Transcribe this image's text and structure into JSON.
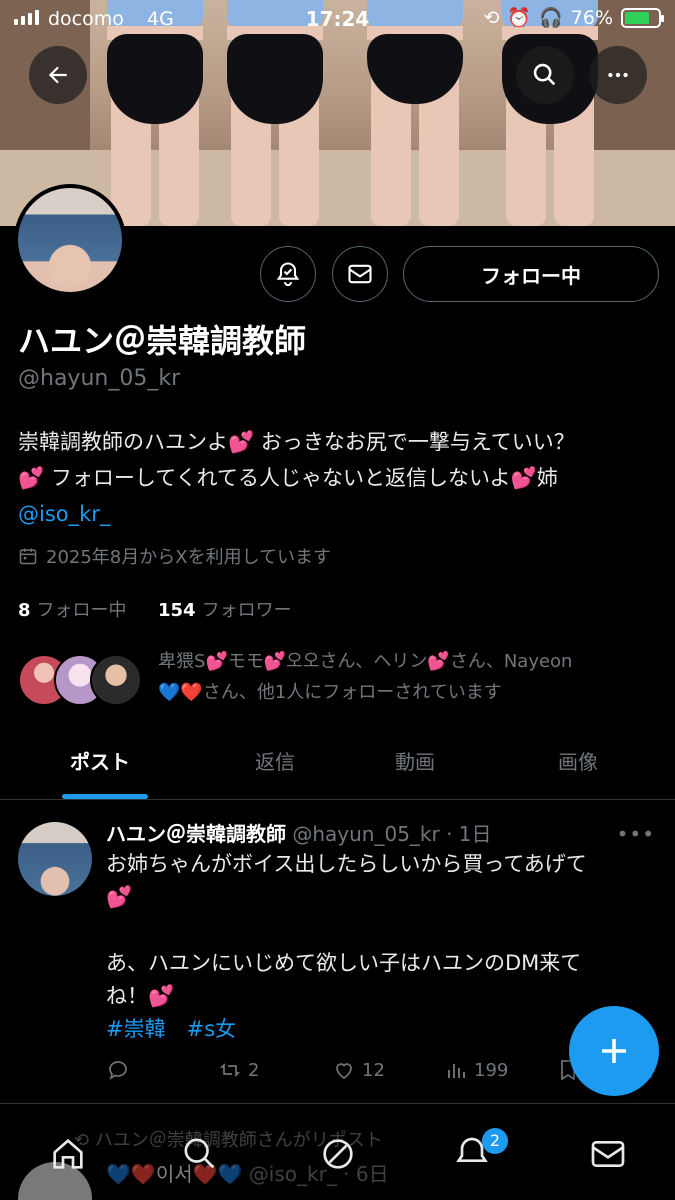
{
  "status_bar": {
    "carrier": "docomo",
    "network": "4G",
    "time": "17:24",
    "battery_percent": "76%",
    "battery_level": 0.76
  },
  "profile": {
    "display_name": "ハユン＠崇韓調教師",
    "handle": "@hayun_05_kr",
    "follow_button": "フォロー中",
    "bio_line1": "崇韓調教師のハユンよ",
    "bio_line1b": " おっきなお尻で一撃与えていい？",
    "bio_line2": " フォローしてくれてる人じゃないと返信しないよ",
    "bio_line2b": "姉",
    "bio_link": "@iso_kr_",
    "joined": "2025年8月からXを利用しています",
    "following_count": "8",
    "following_label": "フォロー中",
    "followers_count": "154",
    "followers_label": "フォロワー",
    "followed_by_1": "卑猥S",
    "followed_by_2": "モモ",
    "followed_by_3": "오오さん、ヘリン",
    "followed_by_4": "さん、Nayeon",
    "followed_by_5": "さん、他1人にフォローされています"
  },
  "tabs": [
    "ポスト",
    "返信",
    "動画",
    "画像"
  ],
  "post": {
    "author": "ハユン＠崇韓調教師",
    "meta": " @hayun_05_kr · 1日",
    "line1": "お姉ちゃんがボイス出したらしいから買ってあげて",
    "line2": "あ、ハユンにいじめて欲しい子はハユンのDM来て",
    "line3": "ね！",
    "tag1": "#崇韓",
    "tag2": "#s女",
    "retweets": "2",
    "likes": "12",
    "views": "199"
  },
  "repost": {
    "label": "ハユン＠崇韓調教師さんがリポスト",
    "name_fragment": "이서",
    "meta": "@iso_kr_ · 6日"
  },
  "notifications_badge": "2",
  "colors": {
    "accent": "#1d9bf0",
    "muted": "#71767b",
    "background": "#000000"
  },
  "icons": [
    "back-arrow-icon",
    "search-icon",
    "more-icon",
    "notification-bell-icon",
    "mail-icon",
    "calendar-icon",
    "reply-icon",
    "retweet-icon",
    "like-icon",
    "views-icon",
    "bookmark-icon",
    "share-icon",
    "home-icon",
    "explore-icon",
    "spaces-icon",
    "plus-icon"
  ]
}
